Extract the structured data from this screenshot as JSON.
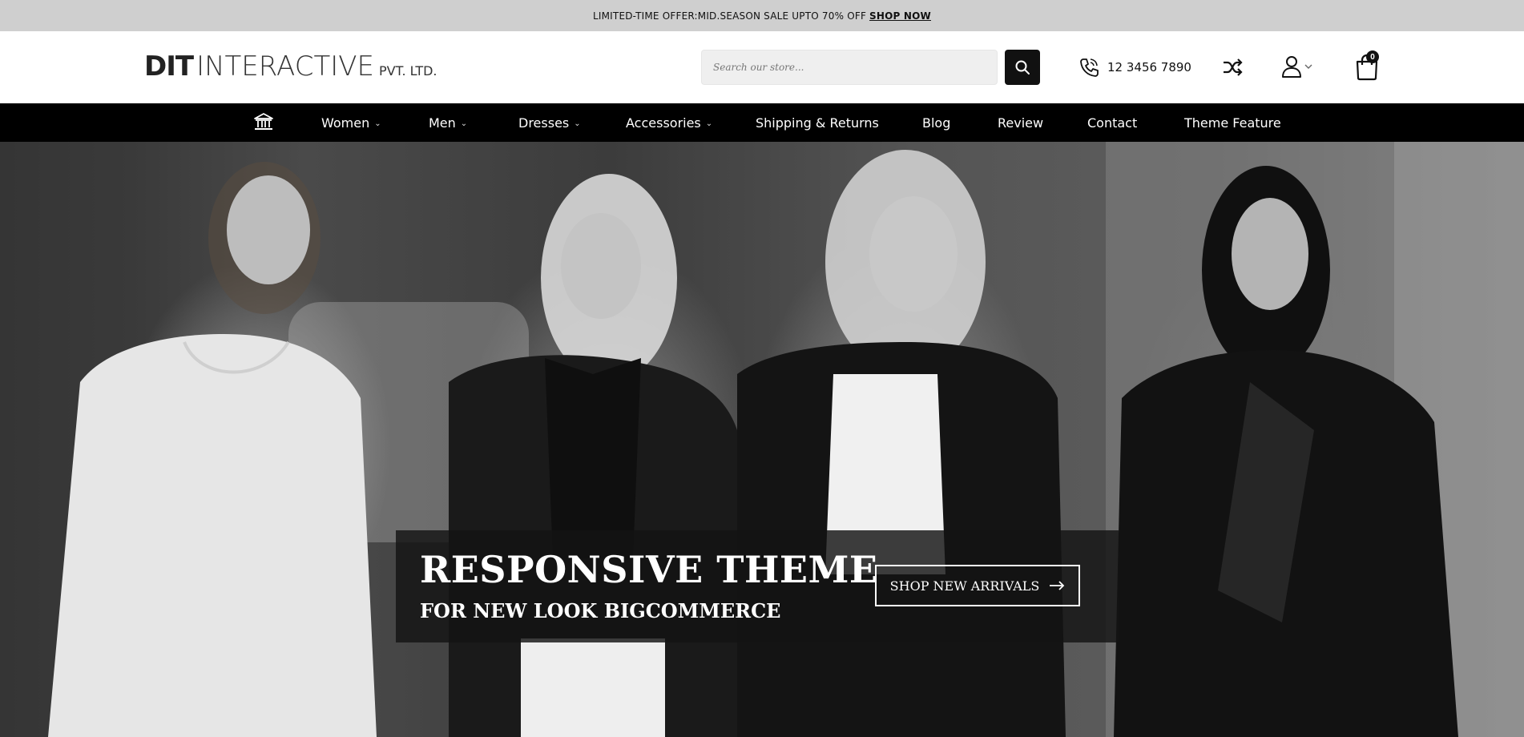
{
  "promo": {
    "text": "LIMITED-TIME OFFER:MID.SEASON SALE UPTO 70% OFF",
    "cta": "SHOP NOW"
  },
  "logo": {
    "part1": "DIT",
    "part2": "INTERACTIVE",
    "part3": "PVT. LTD."
  },
  "search": {
    "placeholder": "Search our store..."
  },
  "phone": {
    "number": "12 3456 7890"
  },
  "cart": {
    "count": "0"
  },
  "nav": {
    "items": [
      {
        "label": "Women",
        "dropdown": true
      },
      {
        "label": "Men",
        "dropdown": true
      },
      {
        "label": "Dresses",
        "dropdown": true
      },
      {
        "label": "Accessories",
        "dropdown": true
      },
      {
        "label": "Shipping & Returns",
        "dropdown": false
      },
      {
        "label": "Blog",
        "dropdown": false
      },
      {
        "label": "Review",
        "dropdown": false
      },
      {
        "label": "Contact",
        "dropdown": false
      },
      {
        "label": "Theme Feature",
        "dropdown": false
      }
    ],
    "chevron": "⌄"
  },
  "hero": {
    "title": "RESPONSIVE THEME",
    "subtitle": "FOR NEW LOOK BIGCOMMERCE",
    "button": "SHOP NEW ARRIVALS"
  },
  "colors": {
    "promo_bg": "#cfcfcf",
    "nav_bg": "#000000",
    "accent": "#111111"
  }
}
